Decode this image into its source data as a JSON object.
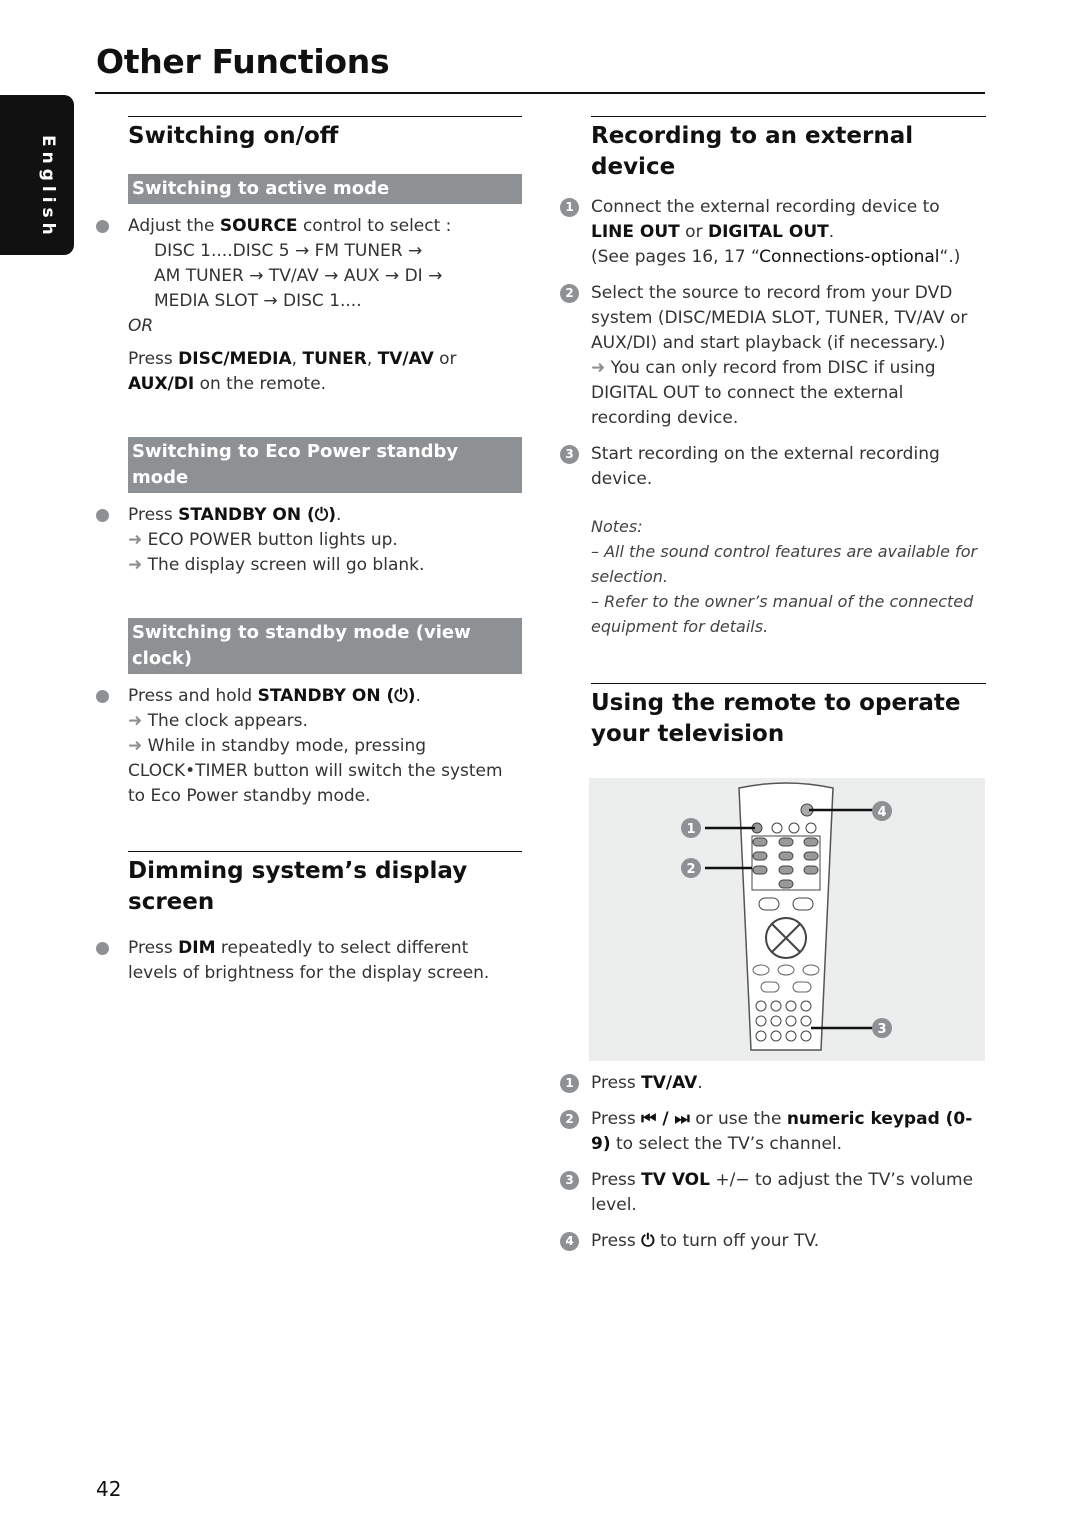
{
  "page": {
    "title": "Other Functions",
    "language_tab": "English",
    "page_number": "42"
  },
  "left": {
    "switching": {
      "heading": "Switching on/off",
      "active": {
        "subhead": "Switching to active mode",
        "adjust_pre": "Adjust the ",
        "adjust_key": "SOURCE",
        "adjust_post": " control to select :",
        "seq1": "DISC 1....DISC 5 → FM TUNER →",
        "seq2": "AM TUNER → TV/AV → AUX → DI →",
        "seq3": "MEDIA SLOT → DISC 1....",
        "or": "OR",
        "press": "Press ",
        "k1": "DISC/MEDIA",
        "sep1": ", ",
        "k2": "TUNER",
        "sep2": ", ",
        "k3": "TV/AV",
        "sep3": " or",
        "k4": "AUX/DI",
        "post": " on the remote."
      },
      "eco": {
        "subhead": "Switching to Eco Power standby mode",
        "press": "Press ",
        "key": "STANDBY ON (⏻)",
        "end": ".",
        "r1": "ECO POWER button lights up.",
        "r2": "The display screen will go blank."
      },
      "standby": {
        "subhead": "Switching to standby mode (view clock)",
        "press": "Press and hold ",
        "key": "STANDBY ON (⏻)",
        "end": ".",
        "r1": "The clock appears.",
        "r2": "While in standby mode, pressing",
        "r2b": "CLOCK•TIMER button will switch the system to Eco Power standby mode."
      }
    },
    "dimming": {
      "heading": "Dimming system’s display screen",
      "press": "Press ",
      "key": "DIM",
      "post": " repeatedly to select different levels of brightness for the display screen."
    }
  },
  "right": {
    "recording": {
      "heading": "Recording to an external device",
      "s1_a": "Connect the external recording device to",
      "s1_k1": "LINE OUT",
      "s1_or": " or ",
      "s1_k2": "DIGITAL OUT",
      "s1_end": ".",
      "s1_see": "(See pages 16, 17 “",
      "s1_see_k": "Connections-optional",
      "s1_see_end": "“.)",
      "s2": "Select the source to record from your DVD system (DISC/MEDIA SLOT, TUNER, TV/AV or AUX/DI) and start playback (if necessary.)",
      "s2_r": "You can only record from DISC if using DIGITAL OUT to connect the external recording device.",
      "s3": "Start recording on the external recording device.",
      "notes_title": "Notes:",
      "note1": "– All the sound control features are available for selection.",
      "note2": "– Refer to the owner’s manual of the connected equipment for details."
    },
    "remote": {
      "heading": "Using the remote to operate your television",
      "callouts": [
        "1",
        "2",
        "3",
        "4"
      ],
      "s1_pre": "Press ",
      "s1_key": "TV/AV",
      "s1_end": ".",
      "s2_pre": "Press ",
      "s2_icons": "⏮ / ⏭",
      "s2_mid": " or use the ",
      "s2_key": "numeric keypad (0-9)",
      "s2_post": " to select the TV’s channel.",
      "s3_pre": "Press ",
      "s3_key": "TV VOL",
      "s3_sym": " +/−",
      "s3_post": "  to adjust the TV’s volume level.",
      "s4_pre": "Press ",
      "s4_icon": "⏻",
      "s4_post": " to turn off your TV."
    }
  }
}
